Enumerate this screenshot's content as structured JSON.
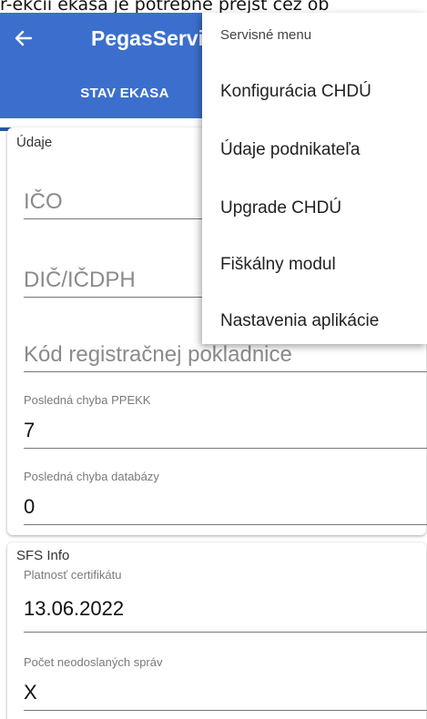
{
  "caption": "r-ekcii ekasa je potrebné prejsť cez ob",
  "appbar": {
    "title": "PegasServis",
    "tab_label": "STAV EKASA",
    "color": "#3c6fcd"
  },
  "card1": {
    "title": "Údaje",
    "fields": {
      "ico_hint": "IČO",
      "dic_hint": "DIČ/IČDPH",
      "kod_hint": "Kód registračnej pokladnice",
      "ppekk_label": "Posledná chyba PPEKK",
      "ppekk_value": "7",
      "db_label": "Posledná chyba databázy",
      "db_value": "0"
    }
  },
  "card2": {
    "title": "SFS Info",
    "fields": {
      "cert_label": "Platnosť certifikátu",
      "cert_value": "13.06.2022",
      "msgs_label": "Počet neodoslaných správ",
      "msgs_value": "X"
    }
  },
  "menu": {
    "header": "Servisné menu",
    "items": [
      "Konfigurácia CHDÚ",
      "Údaje podnikateľa",
      "Upgrade CHDÚ",
      "Fiškálny modul",
      "Nastavenia aplikácie"
    ]
  },
  "icons": {
    "back": "arrow-left-icon"
  }
}
